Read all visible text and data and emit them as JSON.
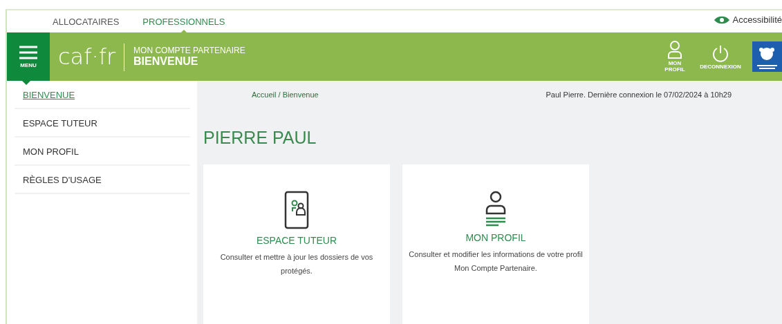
{
  "top_nav": [
    {
      "label": "ALLOCATAIRES",
      "selected": false
    },
    {
      "label": "PROFESSIONNELS",
      "selected": true
    }
  ],
  "accessibility": "Accessibilité",
  "header": {
    "menu_label": "MENU",
    "logo": "caf·fr",
    "subtitle": "MON COMPTE PARTENAIRE",
    "title": "BIENVENUE",
    "actions": [
      {
        "kind": "profile",
        "label": "MON PROFIL"
      },
      {
        "kind": "power",
        "label": "DECONNEXION"
      }
    ]
  },
  "sidebar": {
    "items": [
      {
        "label": "BIENVENUE",
        "selected": true
      },
      {
        "label": "ESPACE TUTEUR",
        "selected": false
      },
      {
        "label": "MON PROFIL",
        "selected": false
      },
      {
        "label": "RÈGLES D'USAGE",
        "selected": false
      }
    ]
  },
  "breadcrumb": "Accueil / Bienvenue",
  "last_login": "Paul Pierre. Dernière connexion le 07/02/2024 à 10h29",
  "page_title": "PIERRE PAUL",
  "cards": [
    {
      "kind": "tutor",
      "title": "ESPACE TUTEUR",
      "text": "Consulter et mettre à jour les dossiers de vos protégés."
    },
    {
      "kind": "profile",
      "title": "MON PROFIL",
      "text": "Consulter et modifier les informations de votre profil Mon Compte Partenaire."
    }
  ]
}
